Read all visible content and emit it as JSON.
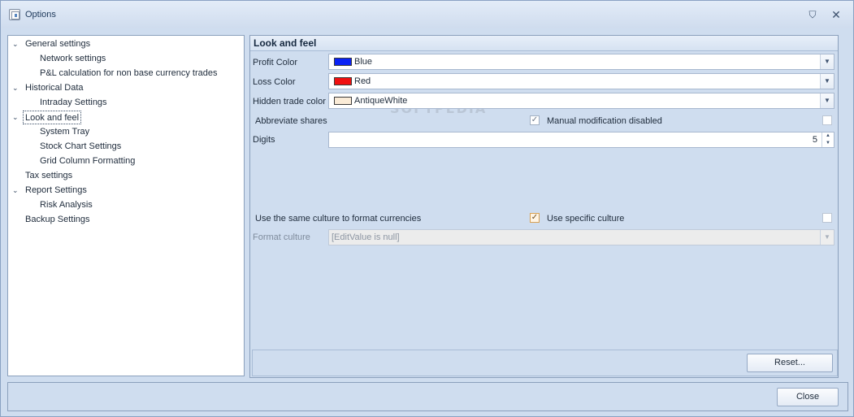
{
  "window": {
    "title": "Options",
    "pin_glyph": "⛉",
    "close_glyph": "✕"
  },
  "watermark": "SOFTPEDIA",
  "tree": [
    {
      "label": "General settings",
      "level": 0,
      "expanded": true
    },
    {
      "label": "Network settings",
      "level": 1
    },
    {
      "label": "P&L calculation for non base currency trades",
      "level": 1
    },
    {
      "label": "Historical Data",
      "level": 0,
      "expanded": true
    },
    {
      "label": "Intraday Settings",
      "level": 1
    },
    {
      "label": "Look and feel",
      "level": 0,
      "expanded": true,
      "selected": true
    },
    {
      "label": "System Tray",
      "level": 1
    },
    {
      "label": "Stock Chart Settings",
      "level": 1
    },
    {
      "label": "Grid Column Formatting",
      "level": 1
    },
    {
      "label": "Tax settings",
      "level": 0
    },
    {
      "label": "Report Settings",
      "level": 0,
      "expanded": true
    },
    {
      "label": "Risk Analysis",
      "level": 1
    },
    {
      "label": "Backup Settings",
      "level": 0
    }
  ],
  "panel": {
    "header": "Look and feel",
    "profit_color": {
      "label": "Profit Color",
      "value": "Blue",
      "swatch": "#0a22f5"
    },
    "loss_color": {
      "label": "Loss Color",
      "value": "Red",
      "swatch": "#f01010"
    },
    "hidden_color": {
      "label": "Hidden trade color",
      "value": "AntiqueWhite",
      "swatch": "#faebd7"
    },
    "abbreviate": {
      "label": "Abbreviate shares",
      "checked": true
    },
    "manual_mod": {
      "label": "Manual modification disabled",
      "checked": false
    },
    "digits": {
      "label": "Digits",
      "value": "5"
    },
    "same_culture": {
      "label": "Use the same culture to format currencies",
      "checked": true
    },
    "specific_culture": {
      "label": "Use specific culture",
      "checked": false
    },
    "format_culture": {
      "label": "Format culture",
      "value": "[EditValue is null]"
    },
    "reset_label": "Reset..."
  },
  "footer": {
    "close_label": "Close"
  },
  "icons": {
    "check": "✓",
    "dropdown": "▼",
    "expand": "⌄",
    "spin_up": "▲",
    "spin_down": "▼"
  }
}
